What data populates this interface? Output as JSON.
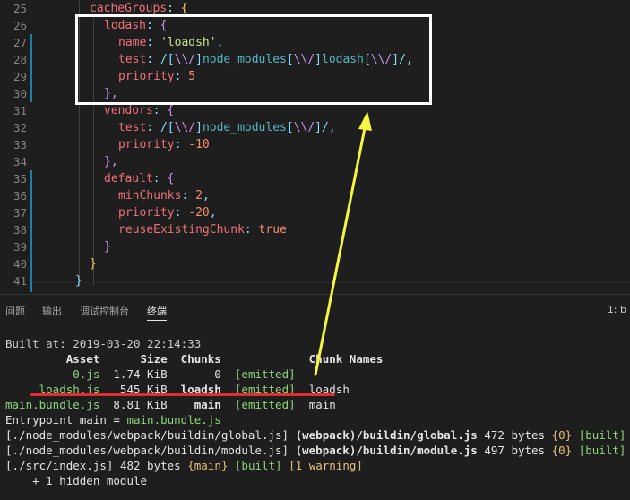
{
  "editor": {
    "line_numbers": [
      "25",
      "26",
      "27",
      "28",
      "29",
      "30",
      "31",
      "32",
      "33",
      "34",
      "35",
      "36",
      "37",
      "38",
      "39",
      "40",
      "41"
    ],
    "lines": {
      "l25": {
        "key": "cacheGroups",
        "colon": ":",
        "brace": " {"
      },
      "l26": {
        "key": "lodash",
        "colon": ":",
        "brace": " {"
      },
      "l27": {
        "key": "name",
        "colon": ":",
        "value": "'loadsh'",
        "trail": ","
      },
      "l28": {
        "key": "test",
        "colon": ":",
        "re_open": " /[",
        "re_esc": "\\\\/",
        "re_close": "]",
        "re_text": "node_modules",
        "re_open2": "[",
        "re_esc2": "\\\\/",
        "re_close2": "]",
        "re_text2": "lodash",
        "re_open3": "[",
        "re_esc3": "\\\\/",
        "re_close3": "]/",
        "trail": ","
      },
      "l29": {
        "key": "priority",
        "colon": ":",
        "value": " 5"
      },
      "l30": {
        "brace": "},"
      },
      "l31": {
        "key": "vendors",
        "colon": ":",
        "brace": " {"
      },
      "l32": {
        "key": "test",
        "colon": ":",
        "re_open": " /[",
        "re_esc": "\\\\/",
        "re_close": "]",
        "re_text": "node_modules",
        "re_open2": "[",
        "re_esc2": "\\\\/",
        "re_close2": "]/",
        "trail": ","
      },
      "l33": {
        "key": "priority",
        "colon": ":",
        "value": " -10"
      },
      "l34": {
        "brace": "},"
      },
      "l35": {
        "key": "default",
        "colon": ":",
        "brace": " {"
      },
      "l36": {
        "key": "minChunks",
        "colon": ":",
        "value": " 2",
        "trail": ","
      },
      "l37": {
        "key": "priority",
        "colon": ":",
        "value": " -20",
        "trail": ","
      },
      "l38": {
        "key": "reuseExistingChunk",
        "colon": ":",
        "value": " true"
      },
      "l39": {
        "brace": "}"
      },
      "l40": {
        "brace": "}"
      },
      "l41": {
        "brace": "}"
      }
    }
  },
  "panel": {
    "tabs": [
      "问题",
      "输出",
      "调试控制台",
      "终端"
    ],
    "active_tab": "终端",
    "right_label": "1: b"
  },
  "terminal": {
    "built_at": "Built at: 2019-03-20 22:14:33",
    "header": "         Asset      Size  Chunks             Chunk Names",
    "rows": [
      {
        "asset": "          0.js",
        "size": "  1.74 KiB",
        "chunks": "       0",
        "status": "  [emitted]",
        "names": ""
      },
      {
        "asset": "     loadsh.js",
        "size": "   545 KiB",
        "chunks": "  loadsh",
        "status": "  [emitted]",
        "names": "  loadsh"
      },
      {
        "asset": "main.bundle.js",
        "size": "  8.81 KiB",
        "chunks": "    main",
        "status": "  [emitted]",
        "names": "  main"
      }
    ],
    "entrypoint_label": "Entrypoint main = ",
    "entrypoint_value": "main.bundle.js",
    "module_lines": [
      {
        "path": "[./node_modules/webpack/buildin/global.js]",
        "source": "(webpack)/buildin/global.js",
        "size": "472 bytes",
        "chunk": "{0}",
        "built": "[built]"
      },
      {
        "path": "[./node_modules/webpack/buildin/module.js]",
        "source": "(webpack)/buildin/module.js",
        "size": "497 bytes",
        "chunk": "{0}",
        "built": "[built]"
      }
    ],
    "index_line": {
      "path": "[./src/index.js]",
      "size": "482 bytes",
      "chunk": "{main}",
      "built": "[built]",
      "warning": "[1 warning]"
    },
    "hidden": "    + 1 hidden module"
  },
  "colors": {
    "highlight_box": "#ffffff",
    "arrow": "#f5f542",
    "underline": "#e12d2d"
  }
}
